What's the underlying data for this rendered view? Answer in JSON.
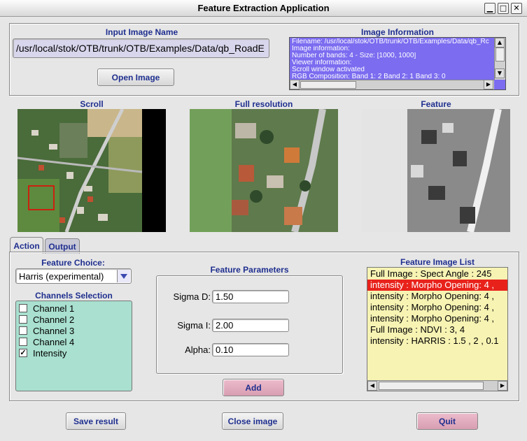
{
  "window": {
    "title": "Feature Extraction Application",
    "buttons": [
      "▁",
      "□",
      "✕"
    ]
  },
  "input_image": {
    "label": "Input Image Name",
    "path": "/usr/local/stok/OTB/trunk/OTB/Examples/Data/qb_RoadE",
    "open_button": "Open Image"
  },
  "image_information": {
    "label": "Image Information",
    "lines": [
      "Filename: /usr/local/stok/OTB/trunk/OTB/Examples/Data/qb_Rc",
      "Image information:",
      "Number of bands: 4 - Size: [1000, 1000]",
      "Viewer information:",
      "Scroll window activated",
      "RGB Composition:  Band 1: 2 Band 2: 1 Band 3: 0"
    ]
  },
  "views": {
    "scroll": "Scroll",
    "full_resolution": "Full resolution",
    "feature": "Feature"
  },
  "tabs": [
    {
      "label": "Action",
      "active": true
    },
    {
      "label": "Output",
      "active": false
    }
  ],
  "feature_choice": {
    "label": "Feature Choice:",
    "selected": "Harris (experimental)"
  },
  "channels": {
    "label": "Channels Selection",
    "items": [
      {
        "label": "Channel 1",
        "checked": false,
        "mark": ""
      },
      {
        "label": "Channel 2",
        "checked": false,
        "mark": ""
      },
      {
        "label": "Channel 3",
        "checked": false,
        "mark": ""
      },
      {
        "label": "Channel 4",
        "checked": false,
        "mark": ""
      },
      {
        "label": "Intensity",
        "checked": true,
        "mark": "✓"
      }
    ]
  },
  "parameters": {
    "label": "Feature Parameters",
    "sigma_d": {
      "label": "Sigma D:",
      "value": "1.50"
    },
    "sigma_i": {
      "label": "Sigma I:",
      "value": "2.00"
    },
    "alpha": {
      "label": "Alpha:",
      "value": "0.10"
    },
    "add_button": "Add"
  },
  "feature_list": {
    "label": "Feature Image List",
    "items": [
      "Full Image : Spect Angle : 245",
      "intensity : Morpho Opening: 4 ,",
      "intensity : Morpho Opening: 4 ,",
      "intensity : Morpho Opening: 4 ,",
      "intensity : Morpho Opening: 4 ,",
      "Full Image : NDVI : 3, 4",
      "intensity : HARRIS : 1.5 , 2 , 0.1"
    ],
    "selected_index": 1
  },
  "bottom": {
    "save": "Save result",
    "close": "Close image",
    "quit": "Quit"
  },
  "colors": {
    "label_blue": "#1f2f8f",
    "info_bg": "#7b6cf0",
    "channels_bg": "#a9e0cf",
    "list_bg": "#f7f3b3",
    "selection": "#e8221b",
    "pink_button": "#d89eb2"
  },
  "icons": {
    "dropdown": "chevron-down-icon",
    "scroll_up": "arrow-up-icon",
    "scroll_down": "arrow-down-icon",
    "scroll_left": "arrow-left-icon",
    "scroll_right": "arrow-right-icon",
    "minimize": "minimize-icon",
    "maximize": "maximize-icon",
    "close": "close-icon"
  }
}
